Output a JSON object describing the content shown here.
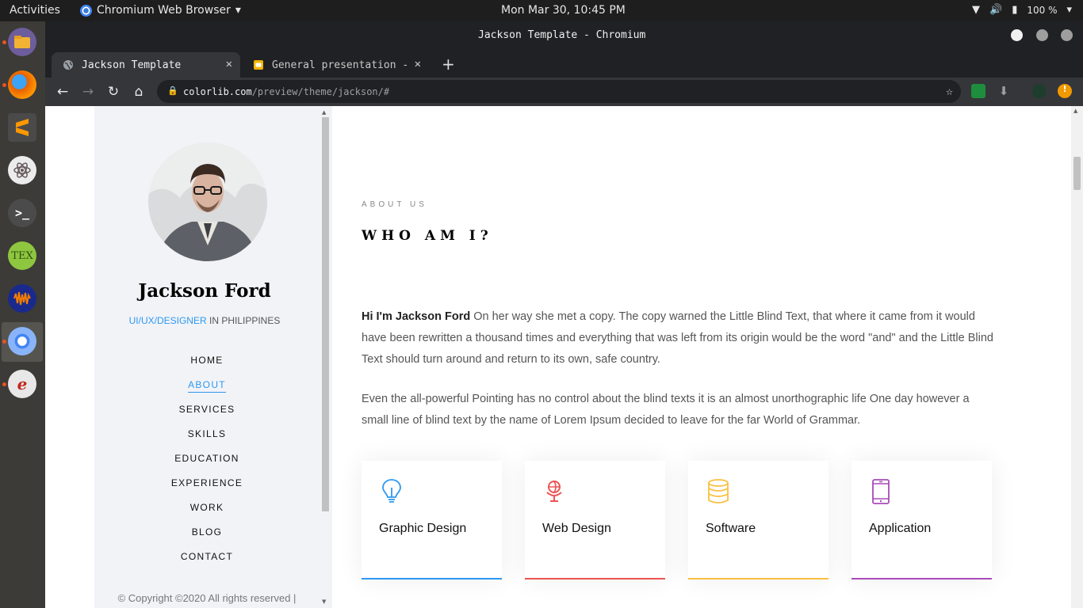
{
  "system_bar": {
    "activities": "Activities",
    "app_name": "Chromium Web Browser",
    "clock": "Mon Mar 30, 10:45 PM",
    "battery": "100 %"
  },
  "dock": {
    "apps": [
      {
        "name": "files"
      },
      {
        "name": "firefox"
      },
      {
        "name": "sublime-text"
      },
      {
        "name": "atom"
      },
      {
        "name": "terminal"
      },
      {
        "name": "texmaker",
        "label": "TEX"
      },
      {
        "name": "audacity"
      },
      {
        "name": "chromium"
      },
      {
        "name": "evince"
      }
    ]
  },
  "window": {
    "title": "Jackson Template - Chromium"
  },
  "tabs": [
    {
      "label": "Jackson Template",
      "active": true
    },
    {
      "label": "General presentation -",
      "active": false
    }
  ],
  "omnibox": {
    "host": "colorlib.com",
    "path": "/preview/theme/jackson/#"
  },
  "sidebar": {
    "name": "Jackson Ford",
    "role_accent": "UI/UX/DESIGNER",
    "role_rest": "IN PHILIPPINES",
    "menu": [
      "HOME",
      "ABOUT",
      "SERVICES",
      "SKILLS",
      "EDUCATION",
      "EXPERIENCE",
      "WORK",
      "BLOG",
      "CONTACT"
    ],
    "active_menu": "ABOUT",
    "copyright": "© Copyright ©2020 All rights reserved |"
  },
  "about": {
    "eyebrow": "ABOUT US",
    "heading": "WHO AM I?",
    "intro_bold": "Hi I'm Jackson Ford",
    "intro_text": " On her way she met a copy. The copy warned the Little Blind Text, that where it came from it would have been rewritten a thousand times and everything that was left from its origin would be the word \"and\" and the Little Blind Text should turn around and return to its own, safe country.",
    "paragraph2": "Even the all-powerful Pointing has no control about the blind texts it is an almost unorthographic life One day however a small line of blind text by the name of Lorem Ipsum decided to leave for the far World of Grammar."
  },
  "services": [
    {
      "label": "Graphic Design",
      "icon": "lightbulb-icon",
      "color": "#2c98f0"
    },
    {
      "label": "Web Design",
      "icon": "globe-icon",
      "color": "#ec5453"
    },
    {
      "label": "Software",
      "icon": "database-icon",
      "color": "#f9bf3f"
    },
    {
      "label": "Application",
      "icon": "tablet-icon",
      "color": "#a84cb8"
    }
  ]
}
